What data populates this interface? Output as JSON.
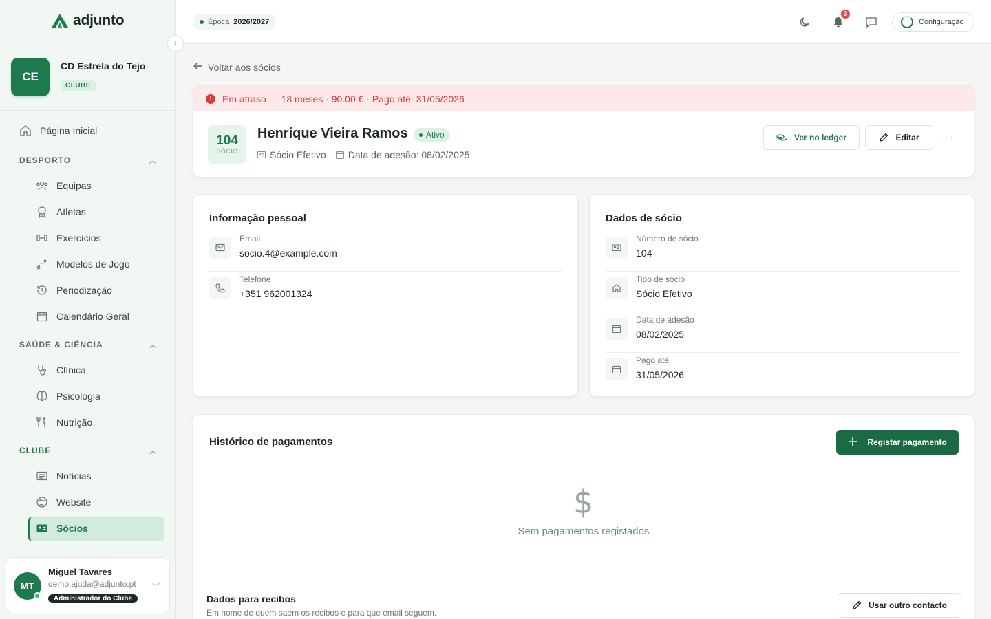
{
  "app": {
    "name": "adjunto"
  },
  "club": {
    "initials": "CE",
    "name": "CD Estrela do Tejo",
    "badge": "CLUBE"
  },
  "sidebar": {
    "home": "Página Inicial",
    "sections": [
      {
        "title": "DESPORTO",
        "items": [
          "Equipas",
          "Atletas",
          "Exercícios",
          "Modelos de Jogo",
          "Periodização",
          "Calendário Geral"
        ]
      },
      {
        "title": "SAÚDE & CIÊNCIA",
        "items": [
          "Clínica",
          "Psicologia",
          "Nutrição"
        ]
      },
      {
        "title": "CLUBE",
        "items": [
          "Notícias",
          "Website",
          "Sócios"
        ]
      }
    ],
    "active": "Sócios"
  },
  "user": {
    "initials": "MT",
    "name": "Miguel Tavares",
    "email": "demo.ajuda@adjunto.pt",
    "role": "Administrador do Clube"
  },
  "topbar": {
    "season_label": "Época",
    "season_value": "2026/2027",
    "notifications": "3",
    "config_label": "Configuração"
  },
  "back_link": "Voltar aos sócios",
  "member": {
    "alert": "Em atraso — 18 meses · 90.00 € · Pago até: 31/05/2026",
    "number": "104",
    "number_label": "SÓCIO",
    "name": "Henrique Vieira Ramos",
    "status": "Ativo",
    "type": "Sócio Efetivo",
    "join_label": "Data de adesão: 08/02/2025",
    "ledger_button": "Ver no ledger",
    "edit_button": "Editar",
    "more": "···"
  },
  "personal": {
    "title": "Informação pessoal",
    "rows": [
      {
        "label": "Email",
        "value": "socio.4@example.com",
        "icon": "mail-icon"
      },
      {
        "label": "Telefone",
        "value": "+351 962001324",
        "icon": "phone-icon"
      }
    ]
  },
  "membership": {
    "title": "Dados de sócio",
    "rows": [
      {
        "label": "Número de sócio",
        "value": "104",
        "icon": "id-card-icon"
      },
      {
        "label": "Tipo de sócio",
        "value": "Sócio Efetivo",
        "icon": "home-icon"
      },
      {
        "label": "Data de adesão",
        "value": "08/02/2025",
        "icon": "calendar-icon"
      },
      {
        "label": "Pago até",
        "value": "31/05/2026",
        "icon": "calendar-icon"
      }
    ]
  },
  "payments": {
    "title": "Histórico de pagamentos",
    "register_button": "Registar pagamento",
    "empty_symbol": "$",
    "empty_text": "Sem pagamentos registados",
    "receipt_title": "Dados para recibos",
    "receipt_sub": "Em nome de quem saem os recibos e para que email seguem.",
    "other_contact_button": "Usar outro contacto"
  },
  "colors": {
    "brand": "#1e7a4c",
    "alert_bg": "#fde9e9",
    "alert_text": "#d93b3b"
  }
}
